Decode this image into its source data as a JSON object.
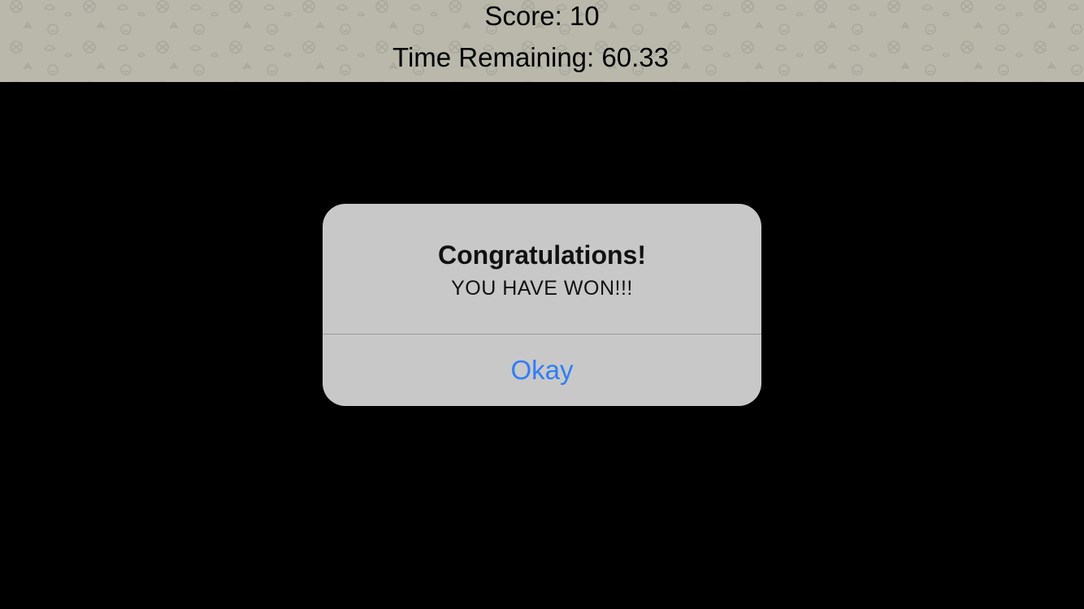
{
  "hud": {
    "score_text": "Score: 10",
    "time_text": "Time Remaining: 60.33",
    "background_color": "#b9b8ab",
    "pattern_icons": [
      "soccer-ball-icon",
      "mushroom-icon",
      "smiley-icon",
      "cloud-icon",
      "star-icon"
    ]
  },
  "alert": {
    "title": "Congratulations!",
    "message": "YOU HAVE WON!!!",
    "button_label": "Okay",
    "button_color": "#2f7df6",
    "background_color": "#c8c8c8"
  },
  "play_area": {
    "background_color": "#000000"
  }
}
